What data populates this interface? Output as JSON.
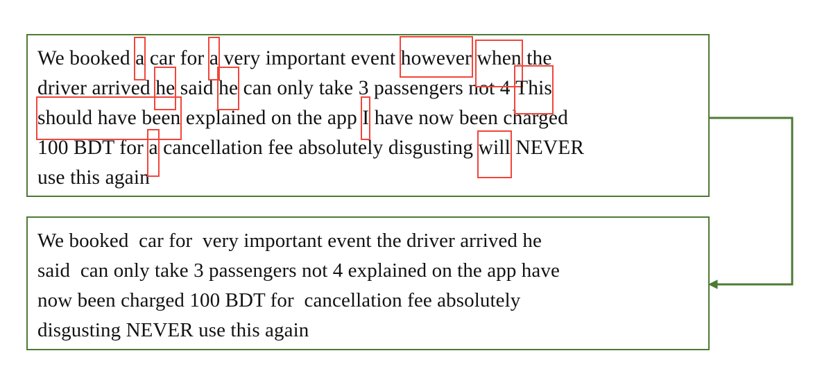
{
  "figure": {
    "accent_border_color": "#4d7a33",
    "highlight_color": "#f2453a",
    "text_color": "#121212",
    "background_color": "#ffffff"
  },
  "original_box": {
    "name": "original-review-text",
    "lines": [
      {
        "segments": [
          {
            "text": "We booked ",
            "highlight": false
          },
          {
            "text": "a",
            "highlight": true
          },
          {
            "text": " car for ",
            "highlight": false
          },
          {
            "text": "a",
            "highlight": true
          },
          {
            "text": " very important event ",
            "highlight": false
          },
          {
            "text": "however",
            "highlight": true
          },
          {
            "text": " ",
            "highlight": false
          },
          {
            "text": "when",
            "highlight": true
          },
          {
            "text": " the",
            "highlight": false
          }
        ]
      },
      {
        "segments": [
          {
            "text": "driver arrived ",
            "highlight": false
          },
          {
            "text": "he",
            "highlight": true
          },
          {
            "text": " said ",
            "highlight": false
          },
          {
            "text": "he",
            "highlight": true
          },
          {
            "text": " can only take 3 passengers not 4 ",
            "highlight": false
          },
          {
            "text": "This",
            "highlight": true
          }
        ]
      },
      {
        "segments": [
          {
            "text": "should have been",
            "highlight": true
          },
          {
            "text": " explained on the app ",
            "highlight": false
          },
          {
            "text": "I",
            "highlight": true
          },
          {
            "text": " have now been charged",
            "highlight": false
          }
        ]
      },
      {
        "segments": [
          {
            "text": "100 BDT for ",
            "highlight": false
          },
          {
            "text": "a",
            "highlight": true
          },
          {
            "text": " cancellation fee absolutely disgusting ",
            "highlight": false
          },
          {
            "text": "will",
            "highlight": true
          },
          {
            "text": " NEVER",
            "highlight": false
          }
        ]
      },
      {
        "segments": [
          {
            "text": "use this again",
            "highlight": false
          }
        ]
      }
    ],
    "full_text": "We booked a car for a very important event however when the driver arrived he said he can only take 3 passengers not 4 This should have been explained on the app I have now been charged 100 BDT for a cancellation fee absolutely disgusting will NEVER use this again",
    "highlighted_words": [
      "a",
      "a",
      "however",
      "when",
      "he",
      "he",
      "This",
      "should have been",
      "I",
      "a",
      "will"
    ]
  },
  "cleaned_box": {
    "name": "cleaned-review-text",
    "lines": [
      "We booked  car for  very important event the driver arrived he",
      "said  can only take 3 passengers not 4 explained on the app have",
      "now been charged 100 BDT for  cancellation fee absolutely",
      "disgusting NEVER use this again"
    ],
    "full_text": "We booked  car for  very important event the driver arrived he said  can only take 3 passengers not 4 explained on the app have now been charged 100 BDT for  cancellation fee absolutely disgusting NEVER use this again"
  },
  "connector": {
    "name": "flow-arrow",
    "from": "original-review-text",
    "to": "cleaned-review-text",
    "direction": "down-left",
    "color": "#4d7a33"
  }
}
